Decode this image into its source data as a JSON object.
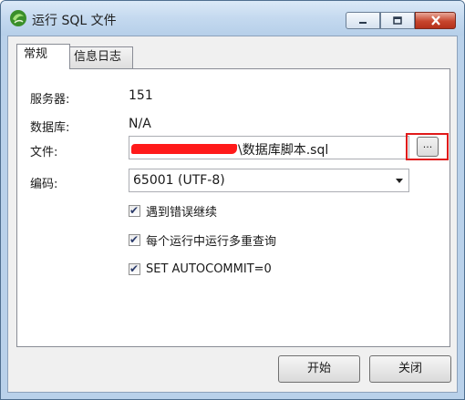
{
  "window": {
    "title": "运行 SQL 文件",
    "icon": "navicat-app-icon",
    "controls": {
      "minimize": "minimize-icon",
      "maximize": "maximize-icon",
      "close": "close-icon"
    }
  },
  "tabs": [
    {
      "label": "常规",
      "active": true
    },
    {
      "label": "信息日志",
      "active": false
    }
  ],
  "form": {
    "server_label": "服务器:",
    "server_value": "151",
    "database_label": "数据库:",
    "database_value": "N/A",
    "file_label": "文件:",
    "file_value": "\\数据库脚本.sql",
    "browse_label": "...",
    "encoding_label": "编码:",
    "encoding_value": "65001 (UTF-8)"
  },
  "options": [
    {
      "label": "遇到错误继续",
      "checked": true
    },
    {
      "label": "每个运行中运行多重查询",
      "checked": true
    },
    {
      "label": "SET AUTOCOMMIT=0",
      "checked": true
    }
  ],
  "buttons": {
    "start": "开始",
    "close": "关闭"
  },
  "colors": {
    "highlight": "#e01a1a",
    "redaction": "#ff1a1a",
    "titlebar": "#c4d9ef"
  }
}
